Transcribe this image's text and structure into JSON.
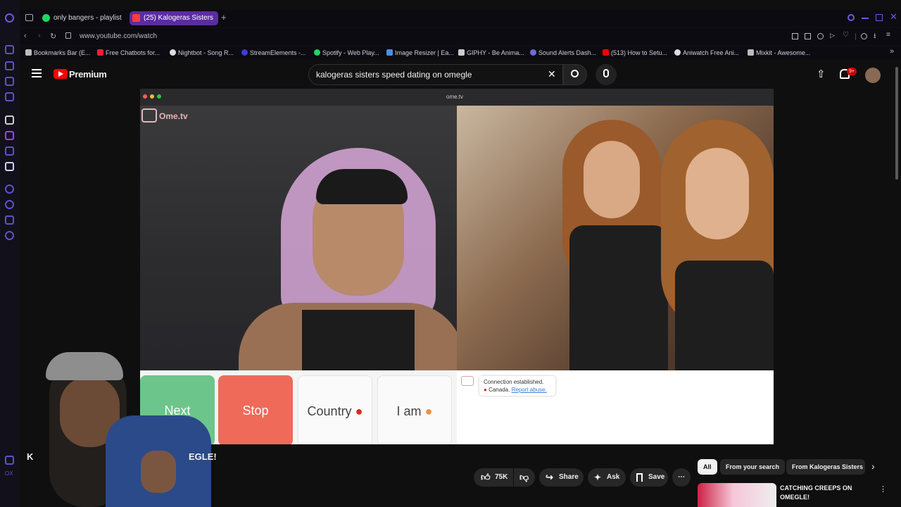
{
  "browser": {
    "tabs": [
      {
        "label": "only bangers - playlist by"
      },
      {
        "label": "(25) Kalogeras Sisters"
      }
    ],
    "url": "www.youtube.com/watch",
    "bookmarks": [
      "Bookmarks Bar (E...",
      "Free Chatbots for...",
      "Nightbot - Song R...",
      "StreamElements -...",
      "Spotify - Web Play...",
      "Image Resizer | Ea...",
      "GIPHY - Be Anima...",
      "Sound Alerts Dash...",
      "(513) How to Setu...",
      "Aniwatch Free Ani...",
      "Mixkit - Awesome..."
    ]
  },
  "youtube": {
    "logo": "Premium",
    "search_value": "kalogeras sisters speed dating on omegle",
    "notif_badge": "9+",
    "video_title_partial_left": "K",
    "video_title_partial_right": "EGLE!",
    "actions": {
      "likes": "75K",
      "share": "Share",
      "ask": "Ask",
      "save": "Save"
    },
    "chips": [
      "All",
      "From your search",
      "From Kalogeras Sisters"
    ],
    "rec_title": "CATCHING CREEPS ON OMEGLE!"
  },
  "ometv": {
    "url": "ome.tv",
    "logo": "Ome.tv",
    "buttons": {
      "next": "Next",
      "stop": "Stop",
      "country": "Country",
      "iam": "I am"
    },
    "chat_line1": "Connection established.",
    "chat_country": "Canada.",
    "chat_report": "Report abuse."
  },
  "colors": {
    "accent": "#5b53c9",
    "yt_red": "#ff0000",
    "next_green": "#6cc58a",
    "stop_red": "#ef6a58"
  }
}
